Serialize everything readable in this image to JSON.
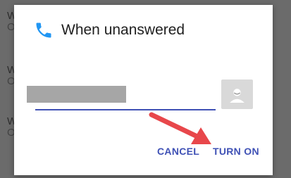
{
  "background_rows": [
    {
      "line1": "W",
      "line2": "O"
    },
    {
      "line1": "W",
      "line2": "O"
    },
    {
      "line1": "W",
      "line2": "O"
    }
  ],
  "dialog": {
    "title": "When unanswered",
    "phone_icon": "phone-icon",
    "number_field": {
      "value": "",
      "redacted": true
    },
    "contact_picker_icon": "contact-avatar-icon",
    "cancel_label": "CANCEL",
    "turn_on_label": "TURN ON"
  },
  "annotation": {
    "type": "arrow",
    "color": "#e8474b",
    "points_to": "turn-on-button"
  },
  "colors": {
    "accent": "#3f51b5",
    "icon": "#2196f3",
    "scrim": "#6b6b6b"
  }
}
